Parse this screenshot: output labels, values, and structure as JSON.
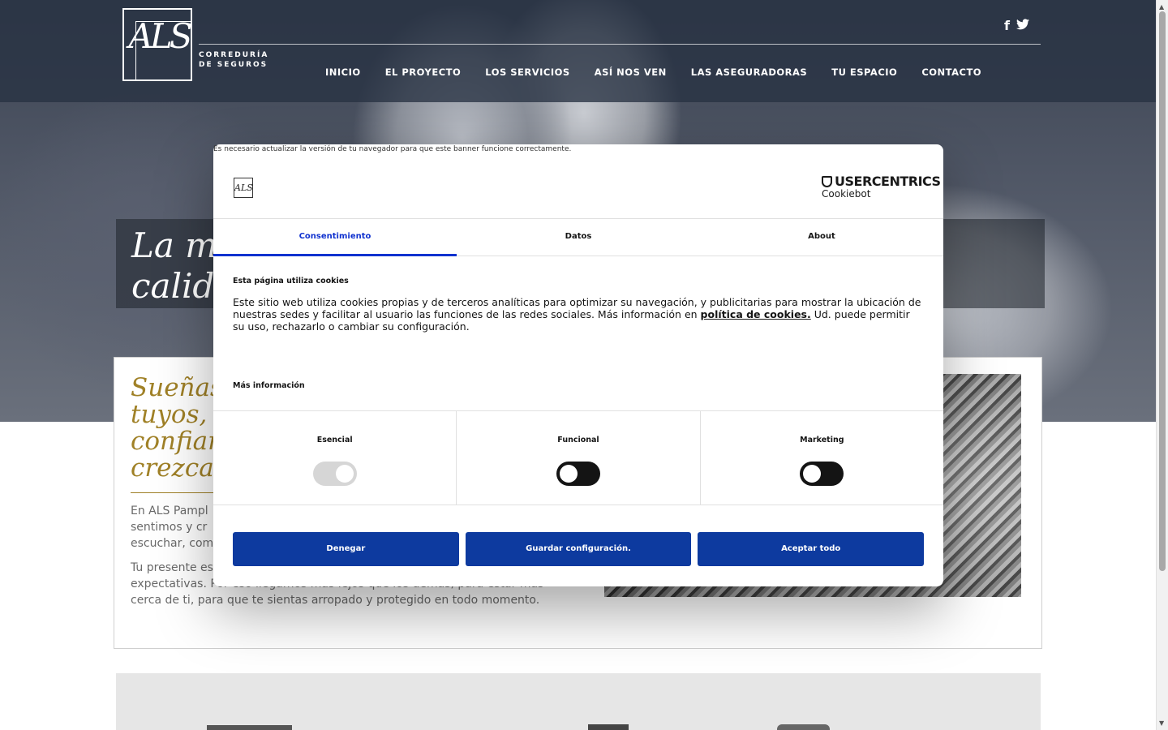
{
  "brand": {
    "logo_text": "ALS",
    "sub_line1": "CORREDURÍA",
    "sub_line2": "DE SEGUROS"
  },
  "social": {
    "facebook": "f",
    "twitter": "🐦"
  },
  "nav": [
    "INICIO",
    "EL PROYECTO",
    "LOS SERVICIOS",
    "ASÍ NOS VEN",
    "LAS ASEGURADORAS",
    "TU ESPACIO",
    "CONTACTO"
  ],
  "hero": {
    "title": "La m\ncalid"
  },
  "content": {
    "heading": "Sueñas\ntuyos,\nconfian\ncrezca",
    "p1": "En ALS Pampl\nsentimos y cr\nescuchar, com",
    "p2": "Tu presente es\nexpectativas. Por eso llegamos más lejos que los demás, para estar más\ncerca de ti, para que te sientas arropado y protegido en todo momento."
  },
  "cookie_banner": {
    "browser_warning": "Es necesario actualizar la versión de tu navegador para que este banner funcione correctamente.",
    "dialog_logo": "ALS",
    "provider_line1": "USERCENTRICS",
    "provider_line2": "Cookiebot",
    "tabs": [
      "Consentimiento",
      "Datos",
      "About"
    ],
    "active_tab": "Consentimiento",
    "body_title": "Esta página utiliza cookies",
    "body_text_before": "Este sitio web utiliza cookies propias y de terceros analíticas para  optimizar su navegación, y publicitarias para mostrar la ubicación de nuestras sedes y facilitar al usuario las funciones de las redes sociales. Más información en ",
    "body_link": "política de cookies.",
    "body_text_after": " Ud. puede permitir su uso, rechazarlo o cambiar su configuración.",
    "more_info": "Más información",
    "categories": [
      {
        "label": "Esencial",
        "state": "on-disabled"
      },
      {
        "label": "Funcional",
        "state": "off"
      },
      {
        "label": "Marketing",
        "state": "off"
      }
    ],
    "buttons": {
      "deny": "Denegar",
      "save": "Guardar configuración.",
      "accept": "Aceptar todo"
    },
    "accent_color": "#0d3a9f",
    "tab_active_color": "#1032cf"
  }
}
